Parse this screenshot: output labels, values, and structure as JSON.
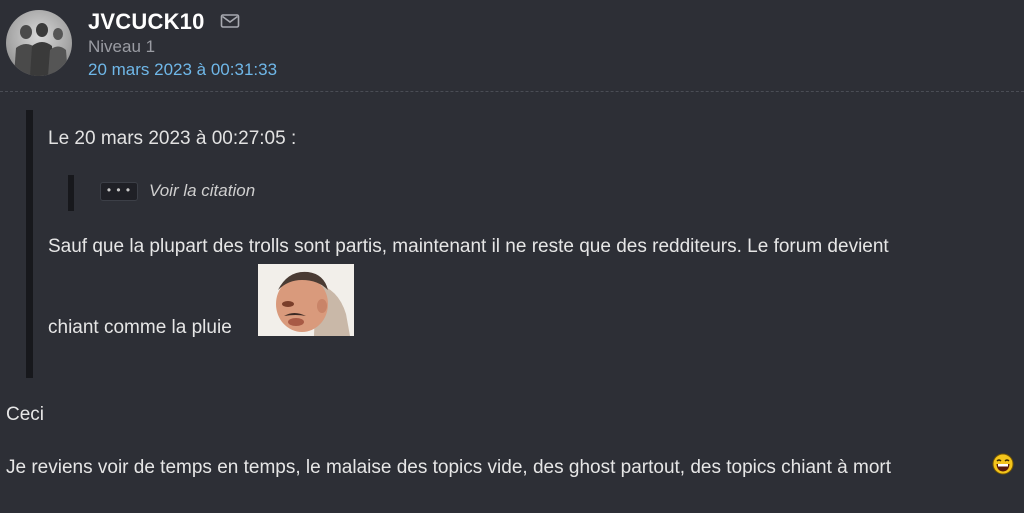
{
  "author": {
    "username": "JVCUCK10",
    "level": "Niveau 1",
    "post_date": "20 mars 2023 à 00:31:33",
    "avatar_icon": "avatar-silhouettes",
    "mail_icon": "mail-icon"
  },
  "quote": {
    "header": "Le 20 mars 2023 à 00:27:05 :",
    "nested": {
      "dots_label": "• • •",
      "toggle_label": "Voir la citation"
    },
    "text_line_1": "Sauf que la plupart des trolls sont partis, maintenant il ne reste que des redditeurs. Le forum devient",
    "text_line_2": "chiant comme la pluie",
    "sticker_icon": "risitas-sticker"
  },
  "message": {
    "line_1": "Ceci",
    "line_2": "Je reviens voir de temps en temps, le malaise des topics vide, des ghost partout, des topics chiant à mort",
    "smiley_icon": "laughing-smiley-icon"
  },
  "colors": {
    "background": "#2d2f36",
    "link": "#6fb7e8",
    "quote_bar": "#17181c"
  }
}
